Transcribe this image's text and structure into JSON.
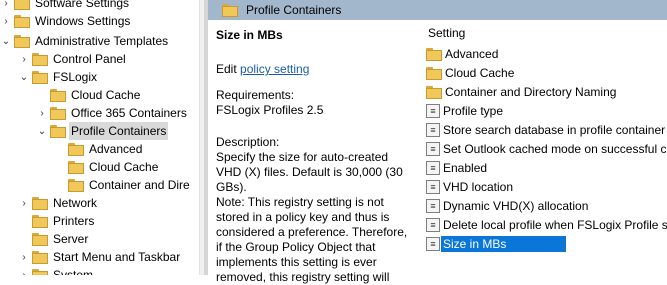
{
  "tree": {
    "items": [
      {
        "label": "Software Settings",
        "chev": "›"
      },
      {
        "label": "Windows Settings",
        "chev": "›"
      },
      {
        "label": "Administrative Templates",
        "chev": "⌄"
      },
      {
        "label": "Control Panel",
        "chev": "›"
      },
      {
        "label": "FSLogix",
        "chev": "⌄"
      },
      {
        "label": "Cloud Cache",
        "chev": ""
      },
      {
        "label": "Office 365 Containers",
        "chev": "›"
      },
      {
        "label": "Profile Containers",
        "chev": "⌄"
      },
      {
        "label": "Advanced",
        "chev": ""
      },
      {
        "label": "Cloud Cache",
        "chev": ""
      },
      {
        "label": "Container and Dire",
        "chev": ""
      },
      {
        "label": "Network",
        "chev": "›"
      },
      {
        "label": "Printers",
        "chev": ""
      },
      {
        "label": "Server",
        "chev": ""
      },
      {
        "label": "Start Menu and Taskbar",
        "chev": "›"
      },
      {
        "label": "System",
        "chev": "›"
      }
    ]
  },
  "header": {
    "title": "Profile Containers"
  },
  "description": {
    "heading": "Size in MBs",
    "edit_prefix": "Edit ",
    "edit_link": "policy setting",
    "req_title": "Requirements:",
    "req_value": "FSLogix Profiles 2.5",
    "desc_title": "Description:",
    "desc_text": "Specify the size for auto-created VHD (X) files. Default is 30,000 (30 GBs).",
    "note_text": "Note:  This registry setting is not stored in a policy key and thus is considered a preference.  Therefore, if the Group Policy Object that implements this setting is ever removed, this registry setting will"
  },
  "settings": {
    "column_header": "Setting",
    "rows": [
      {
        "label": "Advanced",
        "kind": "folder"
      },
      {
        "label": "Cloud Cache",
        "kind": "folder"
      },
      {
        "label": "Container and Directory Naming",
        "kind": "folder"
      },
      {
        "label": "Profile type",
        "kind": "policy"
      },
      {
        "label": "Store search database in profile container",
        "kind": "policy"
      },
      {
        "label": "Set Outlook cached mode on successful co",
        "kind": "policy"
      },
      {
        "label": "Enabled",
        "kind": "policy"
      },
      {
        "label": "VHD location",
        "kind": "policy"
      },
      {
        "label": "Dynamic VHD(X) allocation",
        "kind": "policy"
      },
      {
        "label": "Delete local profile when FSLogix Profile sh",
        "kind": "policy"
      },
      {
        "label": "Size in MBs",
        "kind": "policy",
        "selected": true
      }
    ]
  }
}
